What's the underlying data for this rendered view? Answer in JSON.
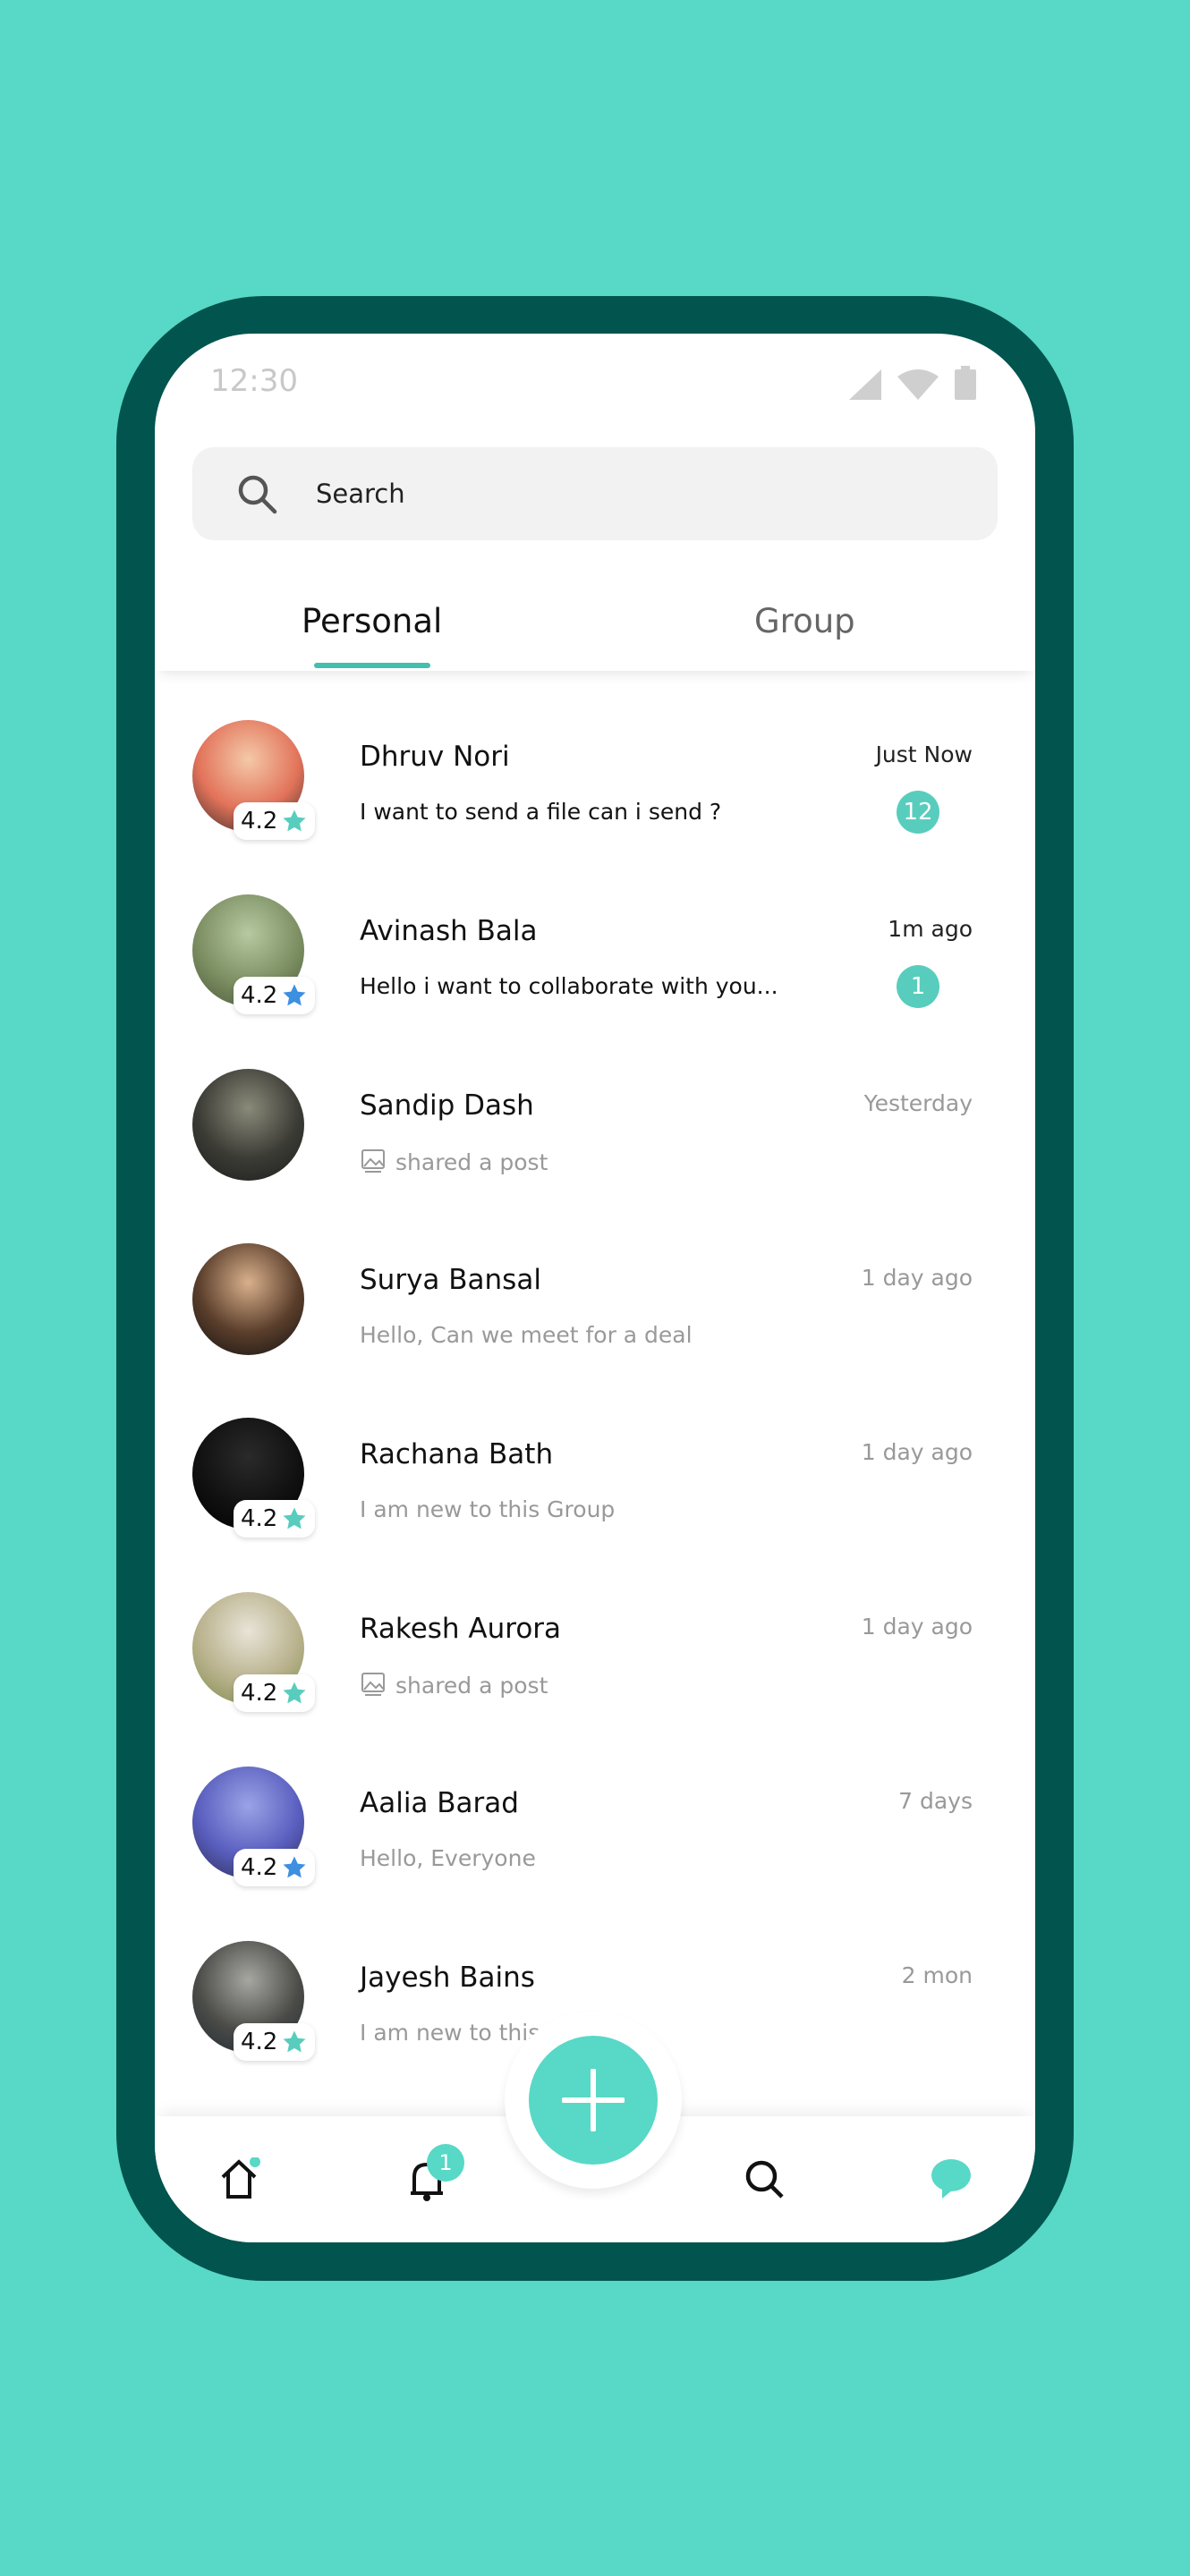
{
  "colors": {
    "background": "#58d8c6",
    "frame": "#02544e",
    "accent": "#58cdbd",
    "star_blue": "#3d8fe0"
  },
  "status_bar": {
    "time": "12:30",
    "icons": [
      "signal-icon",
      "wifi-icon",
      "battery-icon"
    ]
  },
  "search": {
    "placeholder": "Search",
    "icon": "search-icon"
  },
  "tabs": [
    {
      "label": "Personal",
      "active": true
    },
    {
      "label": "Group",
      "active": false
    }
  ],
  "chats": [
    {
      "name": "Dhruv Nori",
      "message": "I want to send a file can i send ?",
      "time": "Just Now",
      "unread": "12",
      "rating": "4.2",
      "star": "teal",
      "bold": true,
      "avatar": [
        "#f4c9a8",
        "#e2735a",
        "#3a2a2a"
      ]
    },
    {
      "name": "Avinash Bala",
      "message": "Hello i want to collaborate with you...",
      "time": "1m ago",
      "unread": "1",
      "rating": "4.2",
      "star": "blue",
      "bold": true,
      "avatar": [
        "#b7c9a0",
        "#7d8f63",
        "#4b5a3b"
      ]
    },
    {
      "name": "Sandip Dash",
      "message": "shared a post",
      "time": "Yesterday",
      "shared": true,
      "avatar": [
        "#8a8a7a",
        "#3c3c36",
        "#1a1a1a"
      ]
    },
    {
      "name": "Surya Bansal",
      "message": "Hello, Can we meet for a deal",
      "time": "1 day  ago",
      "avatar": [
        "#d9b08c",
        "#5a3e2b",
        "#111"
      ]
    },
    {
      "name": "Rachana Bath",
      "message": "I am new to this Group",
      "time": "1 day  ago",
      "rating": "4.2",
      "star": "teal",
      "avatar": [
        "#2a2a2a",
        "#111",
        "#000"
      ]
    },
    {
      "name": "Rakesh Aurora",
      "message": "shared a post",
      "time": "1 day  ago",
      "shared": true,
      "rating": "4.2",
      "star": "teal",
      "avatar": [
        "#e8e4d8",
        "#b9b28d",
        "#7c8a4a"
      ]
    },
    {
      "name": "Aalia Barad",
      "message": "Hello, Everyone",
      "time": "7 days",
      "rating": "4.2",
      "star": "blue",
      "avatar": [
        "#9aa3e6",
        "#5a5fbf",
        "#2c2c55"
      ]
    },
    {
      "name": "Jayesh Bains",
      "message": "I am new to this Group...",
      "time": "2 mon",
      "rating": "4.2",
      "star": "teal",
      "avatar": [
        "#a7a7a2",
        "#4c4c48",
        "#1f2a33"
      ]
    }
  ],
  "bottom_nav": {
    "items": [
      "home-icon",
      "bell-icon",
      "search-icon",
      "chat-icon"
    ],
    "notification_count": "1",
    "fab": "plus-icon"
  }
}
